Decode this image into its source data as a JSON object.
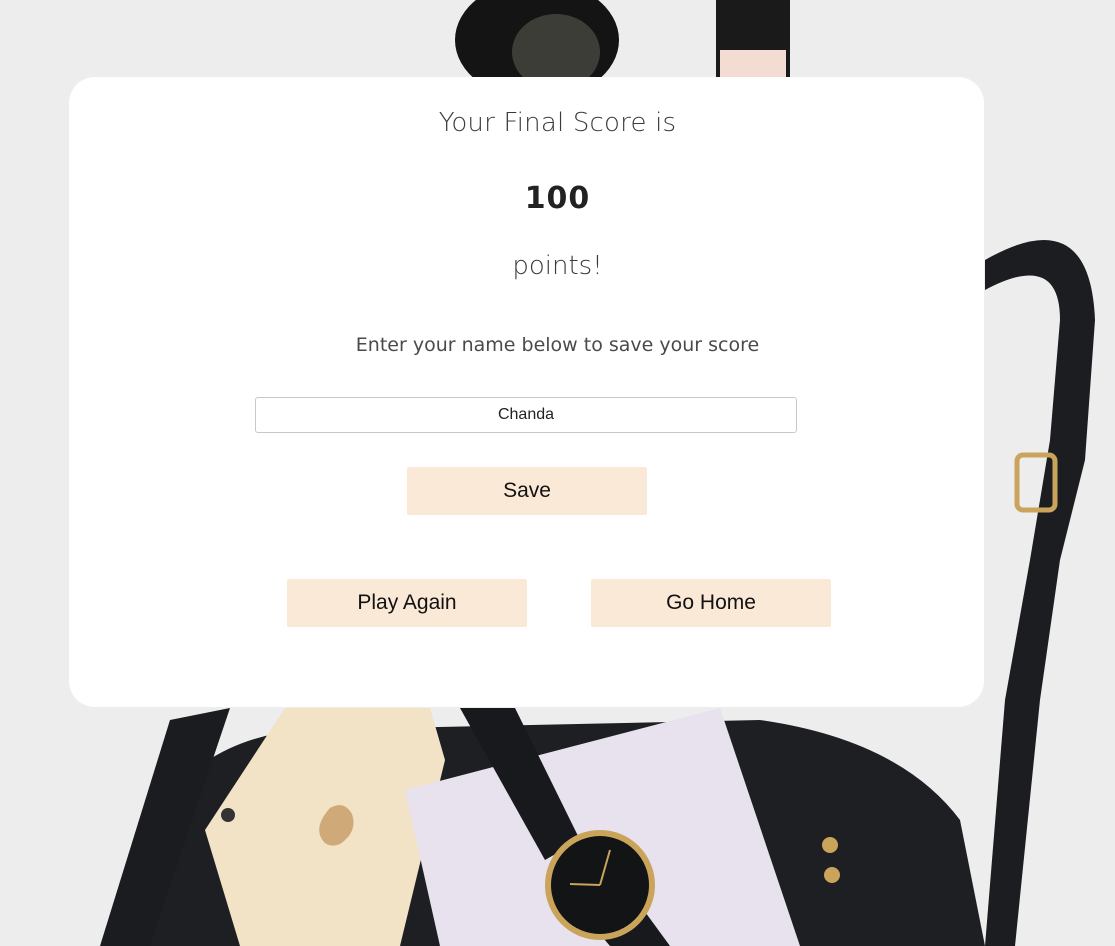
{
  "result": {
    "heading": "Your Final Score is",
    "score": "100",
    "unit": "points!",
    "prompt": "Enter your name below to save your score"
  },
  "form": {
    "name_value": "Chanda"
  },
  "actions": {
    "save_label": "Save",
    "play_again_label": "Play Again",
    "go_home_label": "Go Home"
  },
  "colors": {
    "button_bg": "#fae9d6",
    "card_bg": "#ffffff",
    "page_bg": "#ecebec"
  }
}
